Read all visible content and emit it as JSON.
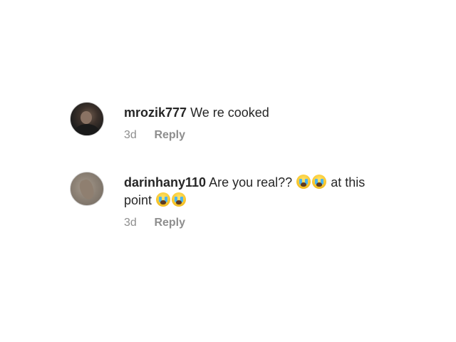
{
  "comments": [
    {
      "username": "mrozik777",
      "text": "We re cooked",
      "time": "3d",
      "reply_label": "Reply"
    },
    {
      "username": "darinhany110",
      "text_before": "Are you real??",
      "emoji_1": "loudly-crying-face-emoji",
      "emoji_2": "loudly-crying-face-emoji",
      "text_after": "at this point",
      "time": "3d",
      "reply_label": "Reply"
    }
  ]
}
